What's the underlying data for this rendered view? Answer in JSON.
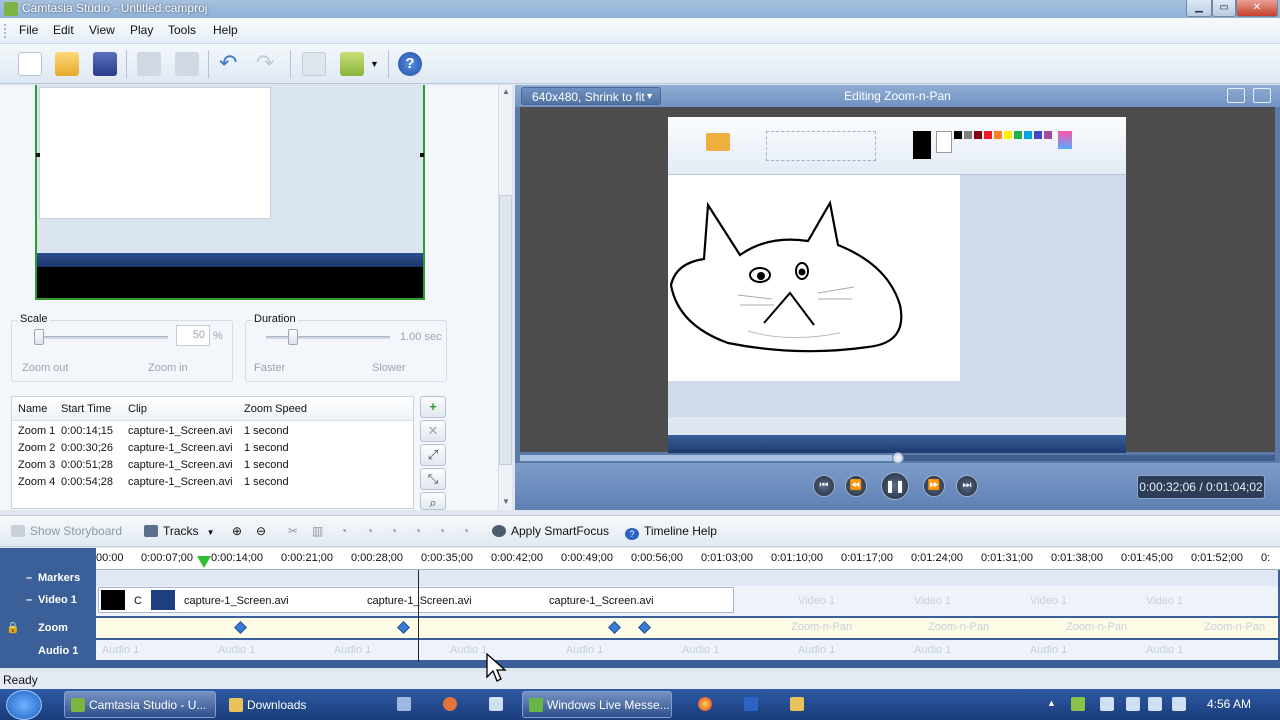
{
  "window": {
    "title": "Camtasia Studio - Untitled.camproj"
  },
  "menu": [
    "File",
    "Edit",
    "View",
    "Play",
    "Tools",
    "Help"
  ],
  "zoom_controls": {
    "scale_label": "Scale",
    "scale_value": "50",
    "scale_unit": "%",
    "zoom_out": "Zoom out",
    "zoom_in": "Zoom in",
    "duration_label": "Duration",
    "duration_value": "1.00 sec",
    "faster": "Faster",
    "slower": "Slower"
  },
  "zoom_table": {
    "headers": [
      "Name",
      "Start Time",
      "Clip",
      "Zoom Speed"
    ],
    "rows": [
      [
        "Zoom 1",
        "0:00:14;15",
        "capture-1_Screen.avi",
        "1 second"
      ],
      [
        "Zoom 2",
        "0:00:30;26",
        "capture-1_Screen.avi",
        "1 second"
      ],
      [
        "Zoom 3",
        "0:00:51;28",
        "capture-1_Screen.avi",
        "1 second"
      ],
      [
        "Zoom 4",
        "0:00:54;28",
        "capture-1_Screen.avi",
        "1 second"
      ]
    ]
  },
  "preview": {
    "dropdown": "640x480, Shrink to fit",
    "title": "Editing Zoom-n-Pan",
    "time": "0:00:32;06 / 0:01:04;02",
    "progress": 0.5
  },
  "timeline_toolbar": {
    "show_storyboard": "Show Storyboard",
    "tracks": "Tracks",
    "apply_smartfocus": "Apply SmartFocus",
    "timeline_help": "Timeline Help"
  },
  "timeline": {
    "ticks": [
      "00:00",
      "0:00:07;00",
      "0:00:14;00",
      "0:00:21;00",
      "0:00:28;00",
      "0:00:35;00",
      "0:00:42;00",
      "0:00:49;00",
      "0:00:56;00",
      "0:01:03;00",
      "0:01:10;00",
      "0:01:17;00",
      "0:01:24;00",
      "0:01:31;00",
      "0:01:38;00",
      "0:01:45;00",
      "0:01:52;00",
      "0:"
    ],
    "tracks": {
      "markers": "Markers",
      "video1": "Video 1",
      "zoom": "Zoom",
      "audio1": "Audio 1"
    },
    "clip_short": "C",
    "clip_name": "capture-1_Screen.avi",
    "ghost_video": "Video 1",
    "ghost_zoom": "Zoom-n-Pan",
    "ghost_audio": "Audio 1"
  },
  "status": "Ready",
  "taskbar": {
    "items": [
      "Camtasia Studio - U...",
      "Downloads",
      "Windows Live Messe..."
    ],
    "clock": "4:56 AM"
  },
  "colors": {
    "accent": "#3b5f98",
    "playhead": "#2ec02e",
    "selection_border": "#2f9b2f"
  }
}
